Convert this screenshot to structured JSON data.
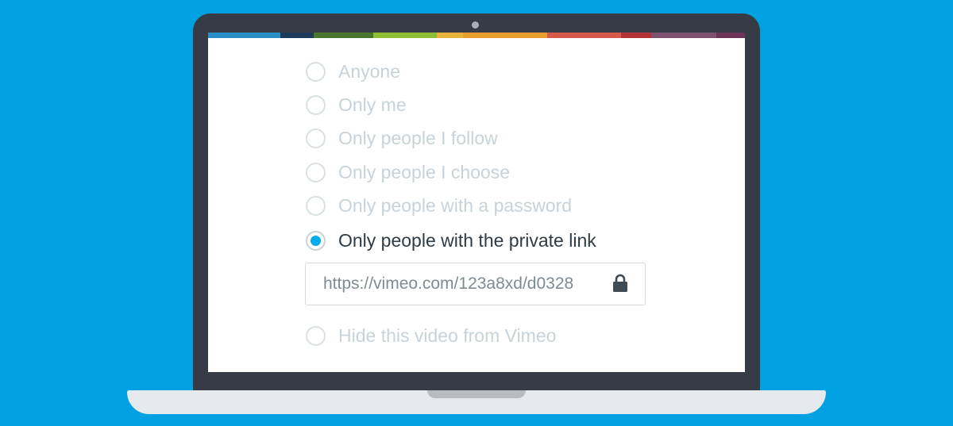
{
  "colors": {
    "background": "#00a1e0",
    "accent": "#00adef",
    "strip": [
      "#2a8fc6",
      "#1f3b5b",
      "#47762c",
      "#8fbe35",
      "#e6b43b",
      "#e89d2c",
      "#d65a4c",
      "#b23238",
      "#7d5271",
      "#6b3458"
    ]
  },
  "privacy": {
    "options": [
      {
        "label": "Anyone",
        "selected": false
      },
      {
        "label": "Only me",
        "selected": false
      },
      {
        "label": "Only people I follow",
        "selected": false
      },
      {
        "label": "Only people I choose",
        "selected": false
      },
      {
        "label": "Only people with a password",
        "selected": false
      },
      {
        "label": "Only people with the private link",
        "selected": true
      }
    ],
    "private_link": "https://vimeo.com/123a8xd/d0328",
    "lock_icon": "lock-icon",
    "hide_option": {
      "label": "Hide this video from Vimeo",
      "selected": false
    }
  }
}
